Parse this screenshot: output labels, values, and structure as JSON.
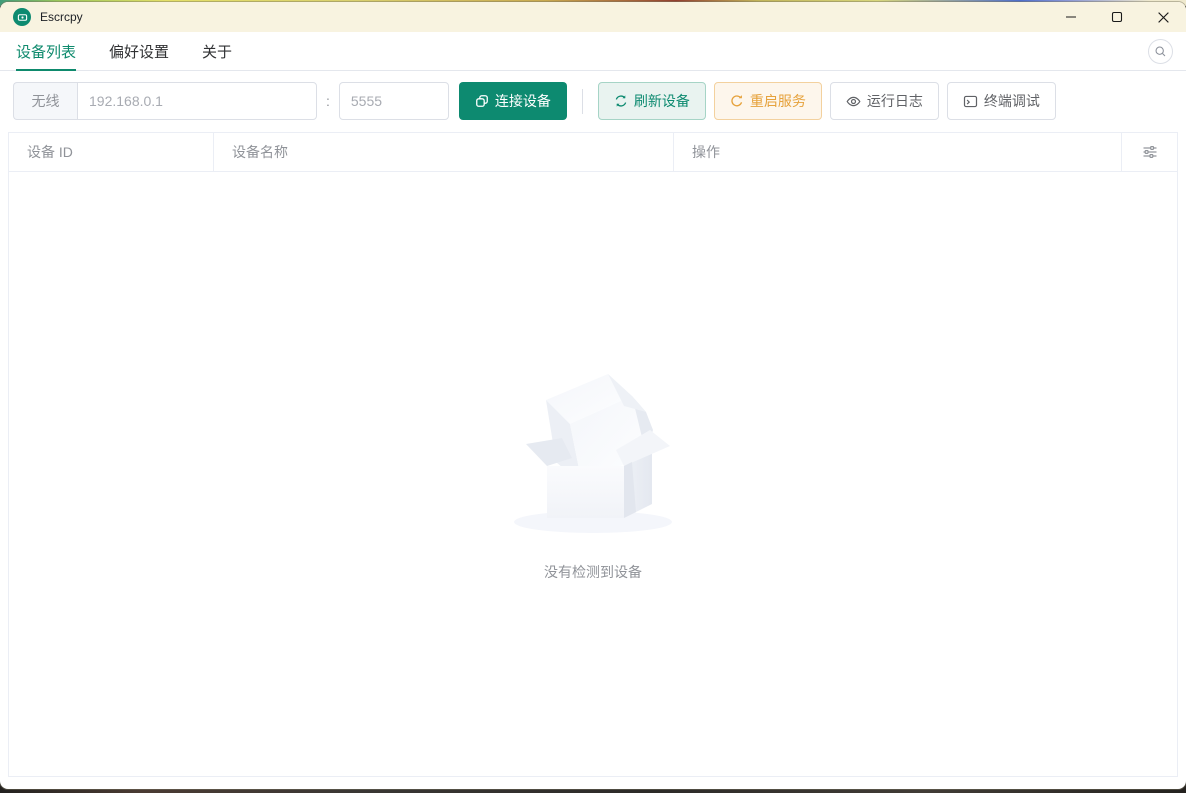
{
  "window": {
    "title": "Escrcpy",
    "controls": {
      "minimize": "minimize-icon",
      "maximize": "maximize-icon",
      "close": "close-icon"
    }
  },
  "tabs": [
    {
      "label": "设备列表",
      "active": true
    },
    {
      "label": "偏好设置",
      "active": false
    },
    {
      "label": "关于",
      "active": false
    }
  ],
  "toolbar": {
    "wireless_label": "无线",
    "ip": {
      "placeholder": "192.168.0.1"
    },
    "separator": ":",
    "port": {
      "placeholder": "5555"
    },
    "connect_label": "连接设备",
    "refresh_label": "刷新设备",
    "restart_label": "重启服务",
    "logs_label": "运行日志",
    "terminal_label": "终端调试"
  },
  "table": {
    "columns": [
      {
        "label": "设备 ID"
      },
      {
        "label": "设备名称"
      },
      {
        "label": "操作"
      }
    ]
  },
  "empty_state": {
    "message": "没有检测到设备"
  },
  "icons": {
    "app": "escrcpy-logo",
    "connect": "link-icon",
    "refresh": "refresh-icon",
    "restart": "refresh-right-icon",
    "logs": "eye-icon",
    "terminal": "terminal-icon",
    "column_settings": "sliders-icon",
    "search": "search-icon"
  },
  "colors": {
    "primary": "#0d8a70",
    "warning": "#e6a23c",
    "titlebar_bg": "#f8f3e0",
    "table_border": "#ebeef5",
    "muted_text": "#909399"
  }
}
